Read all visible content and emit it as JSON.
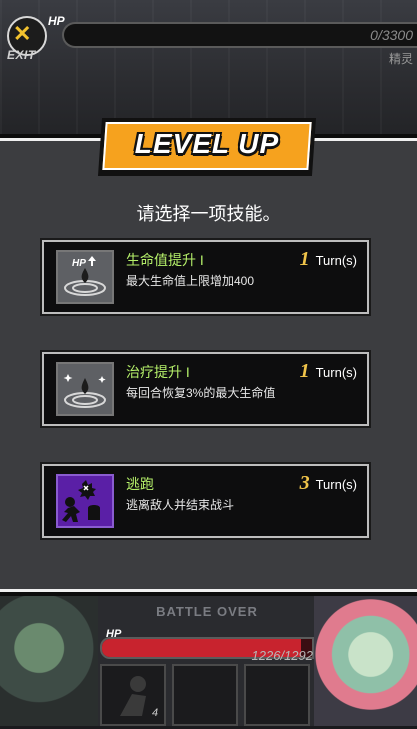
{
  "top_hud": {
    "exit_label": "EXIT",
    "hp_label": "HP",
    "enemy_hp": "0/3300",
    "enemy_hp_fraction": 0,
    "enemy_rank": "精灵"
  },
  "dialog": {
    "banner_title": "LEVEL UP",
    "prompt": "请选择一项技能。",
    "options": [
      {
        "icon": "hp-up-icon",
        "name": "生命值提升 I",
        "turns_count": "1",
        "turns_unit": "Turn(s)",
        "description": "最大生命值上限增加400"
      },
      {
        "icon": "heal-icon",
        "name": "治疗提升 I",
        "turns_count": "1",
        "turns_unit": "Turn(s)",
        "description": "每回合恢复3%的最大生命值"
      },
      {
        "icon": "escape-icon",
        "name": "逃跑",
        "turns_count": "3",
        "turns_unit": "Turn(s)",
        "description": "逃离敌人并结束战斗"
      }
    ]
  },
  "bottom_hud": {
    "banner": "BATTLE OVER",
    "hp_label": "HP",
    "player_hp": "1226/1292",
    "player_hp_fraction": 0.949,
    "slot_count": "4"
  },
  "colors": {
    "accent": "#f6a21e",
    "skill_name": "#b5f06a",
    "turn_number": "#f0c44a",
    "hp_red": "#c8232e",
    "escape_purple": "#5a1fa6"
  }
}
